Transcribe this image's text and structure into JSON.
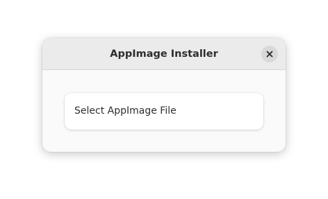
{
  "window": {
    "title": "AppImage Installer"
  },
  "header": {
    "close_icon": "close-icon"
  },
  "main": {
    "select_file_label": "Select AppImage File"
  }
}
